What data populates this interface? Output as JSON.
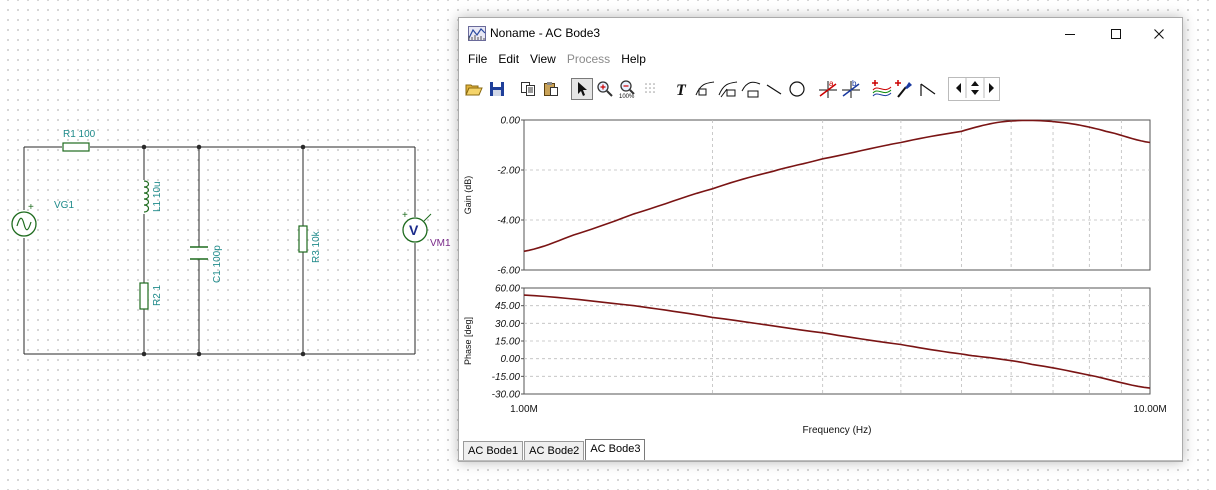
{
  "schematic": {
    "components": [
      {
        "id": "r1",
        "label": "R1 100"
      },
      {
        "id": "vg1",
        "label": "VG1"
      },
      {
        "id": "l1",
        "label": "L1 10u"
      },
      {
        "id": "r2",
        "label": "R2 1"
      },
      {
        "id": "c1",
        "label": "C1 100p"
      },
      {
        "id": "r3",
        "label": "R3 10k"
      },
      {
        "id": "vm1",
        "label": "VM1"
      }
    ],
    "voltmeter_symbol": "V"
  },
  "window": {
    "title": "Noname - AC Bode3",
    "icon": "bode-plot-icon",
    "controls": [
      "minimize-icon",
      "maximize-icon",
      "close-icon"
    ]
  },
  "menu": [
    {
      "label": "File",
      "enabled": true
    },
    {
      "label": "Edit",
      "enabled": true
    },
    {
      "label": "View",
      "enabled": true
    },
    {
      "label": "Process",
      "enabled": false
    },
    {
      "label": "Help",
      "enabled": true
    }
  ],
  "toolbar": [
    {
      "name": "open-icon"
    },
    {
      "name": "save-icon"
    },
    {
      "sep": true
    },
    {
      "name": "copy-icon"
    },
    {
      "name": "paste-icon"
    },
    {
      "sep": true
    },
    {
      "name": "pointer-icon",
      "pressed": true
    },
    {
      "name": "zoom-in-icon"
    },
    {
      "name": "zoom-100-icon"
    },
    {
      "name": "grid-icon"
    },
    {
      "sep": true
    },
    {
      "name": "text-icon"
    },
    {
      "name": "curve-label-icon"
    },
    {
      "name": "curve-label-2-icon"
    },
    {
      "name": "curve-label-3-icon"
    },
    {
      "name": "line-icon"
    },
    {
      "name": "circle-icon"
    },
    {
      "sep": true
    },
    {
      "name": "cursor-a-icon"
    },
    {
      "name": "cursor-b-icon"
    },
    {
      "sep": true
    },
    {
      "name": "add-curve-icon"
    },
    {
      "name": "marker-icon"
    },
    {
      "name": "slope-icon"
    },
    {
      "sep": true
    },
    {
      "name": "arrows-icon"
    }
  ],
  "tabs": [
    "AC Bode1",
    "AC Bode2",
    "AC Bode3"
  ],
  "active_tab": 2,
  "chart_data": [
    {
      "type": "line",
      "ylabel": "Gain (dB)",
      "xlabel": "",
      "xscale": "log",
      "xlim": [
        1000000,
        10000000
      ],
      "ylim": [
        -6,
        0
      ],
      "yticks": [
        "0.00",
        "-2.00",
        "-4.00",
        "-6.00"
      ],
      "grid": true,
      "series_color": "#7a1414",
      "x": [
        1000000,
        1200000,
        1500000,
        2000000,
        2500000,
        3000000,
        4000000,
        5000000,
        5700000,
        6500000,
        7500000,
        8500000,
        10000000
      ],
      "y": [
        -5.25,
        -4.6,
        -3.75,
        -2.75,
        -2.05,
        -1.55,
        -0.9,
        -0.45,
        -0.1,
        -0.02,
        -0.15,
        -0.45,
        -0.9
      ]
    },
    {
      "type": "line",
      "ylabel": "Phase [deg]",
      "xlabel": "Frequency (Hz)",
      "xscale": "log",
      "xlim": [
        1000000,
        10000000
      ],
      "ylim": [
        -30,
        60
      ],
      "yticks": [
        "60.00",
        "45.00",
        "30.00",
        "15.00",
        "0.00",
        "-15.00",
        "-30.00"
      ],
      "xtick_labels": [
        "1.00M",
        "10.00M"
      ],
      "grid": true,
      "series_color": "#7a1414",
      "x": [
        1000000,
        1500000,
        2000000,
        3000000,
        4000000,
        5000000,
        5700000,
        6500000,
        8000000,
        10000000
      ],
      "y": [
        54,
        45,
        35,
        22,
        12,
        4,
        0,
        -5,
        -14,
        -25
      ]
    }
  ]
}
